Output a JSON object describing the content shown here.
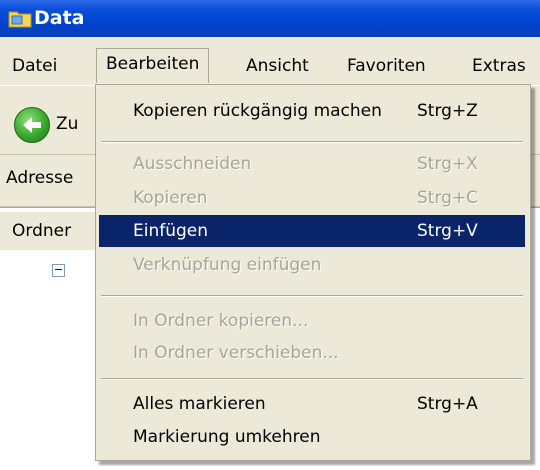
{
  "window": {
    "title": "Data"
  },
  "menubar": {
    "items": [
      "Datei",
      "Bearbeiten",
      "Ansicht",
      "Favoriten",
      "Extras"
    ]
  },
  "toolbar": {
    "back_label": "Zu"
  },
  "addressbar": {
    "label": "Adresse"
  },
  "folders": {
    "header": "Ordner"
  },
  "dropdown": {
    "items": [
      {
        "label": "Kopieren rückgängig machen",
        "shortcut": "Strg+Z"
      },
      {
        "label": "Ausschneiden",
        "shortcut": "Strg+X"
      },
      {
        "label": "Kopieren",
        "shortcut": "Strg+C"
      },
      {
        "label": "Einfügen",
        "shortcut": "Strg+V"
      },
      {
        "label": "Verknüpfung einfügen",
        "shortcut": ""
      },
      {
        "label": "In Ordner kopieren...",
        "shortcut": ""
      },
      {
        "label": "In Ordner verschieben...",
        "shortcut": ""
      },
      {
        "label": "Alles markieren",
        "shortcut": "Strg+A"
      },
      {
        "label": "Markierung umkehren",
        "shortcut": ""
      }
    ]
  },
  "colors": {
    "titlebar": "#0045d0",
    "menu_bg": "#ece9d8",
    "selection": "#0a246a",
    "disabled_text": "#a8a596"
  }
}
